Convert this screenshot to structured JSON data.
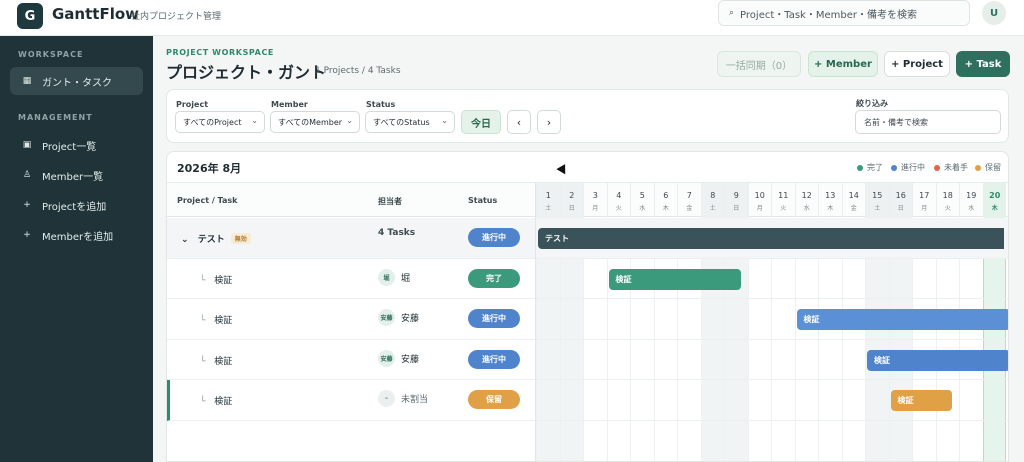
{
  "header": {
    "logo_letter": "G",
    "app_name": "GanttFlow",
    "subtitle": "社内プロジェクト管理",
    "search_placeholder": "Project・Task・Member・備考を検索",
    "search_icon": "search-icon",
    "avatar_initial": "U"
  },
  "sidebar": {
    "section_workspace": "WORKSPACE",
    "section_management": "MANAGEMENT",
    "items": [
      {
        "label": "ガント・タスク",
        "icon": "▦",
        "active": true
      },
      {
        "label": "Project一覧",
        "icon": "▣",
        "active": false
      },
      {
        "label": "Member一覧",
        "icon": "♙",
        "active": false
      },
      {
        "label": "Projectを追加",
        "icon": "+",
        "active": false
      },
      {
        "label": "Memberを追加",
        "icon": "+",
        "active": false
      }
    ]
  },
  "page": {
    "eyebrow": "PROJECT WORKSPACE",
    "title": "プロジェクト・ガント",
    "counts": "1 Projects / 4 Tasks"
  },
  "actions": {
    "sync": "一括同期（0）",
    "member": "+ Member",
    "project": "+ Project",
    "task": "+ Task"
  },
  "filters": {
    "project_label": "Project",
    "project_value": "すべてのProject",
    "member_label": "Member",
    "member_value": "すべてのMember",
    "status_label": "Status",
    "status_value": "すべてのStatus",
    "today": "今日",
    "prev": "‹",
    "next": "›",
    "narrow_label": "絞り込み",
    "narrow_placeholder": "名前・備考で検索"
  },
  "gantt": {
    "month": "2026年 8月",
    "legend": [
      {
        "label": "完了",
        "color": "#3b9a7c"
      },
      {
        "label": "進行中",
        "color": "#4f84cc"
      },
      {
        "label": "未着手",
        "color": "#e0644a"
      },
      {
        "label": "保留",
        "color": "#e0a045"
      }
    ],
    "columns": {
      "task": "Project / Task",
      "assignee": "担当者",
      "status": "Status"
    },
    "days": [
      {
        "n": "1",
        "w": "土"
      },
      {
        "n": "2",
        "w": "日"
      },
      {
        "n": "3",
        "w": "月"
      },
      {
        "n": "4",
        "w": "火"
      },
      {
        "n": "5",
        "w": "水"
      },
      {
        "n": "6",
        "w": "木"
      },
      {
        "n": "7",
        "w": "金"
      },
      {
        "n": "8",
        "w": "土"
      },
      {
        "n": "9",
        "w": "日"
      },
      {
        "n": "10",
        "w": "月"
      },
      {
        "n": "11",
        "w": "火"
      },
      {
        "n": "12",
        "w": "水"
      },
      {
        "n": "13",
        "w": "木"
      },
      {
        "n": "14",
        "w": "金"
      },
      {
        "n": "15",
        "w": "土"
      },
      {
        "n": "16",
        "w": "日"
      },
      {
        "n": "17",
        "w": "月"
      },
      {
        "n": "18",
        "w": "火"
      },
      {
        "n": "19",
        "w": "水"
      },
      {
        "n": "20",
        "w": "木"
      }
    ],
    "rows": [
      {
        "type": "parent",
        "name": "テスト",
        "badge": "無効",
        "assignee": "4 Tasks",
        "status": "進行中",
        "status_color": "#4f84cc",
        "bar": {
          "label": "テスト",
          "start": 1,
          "end": 20,
          "color": "#3a525a"
        }
      },
      {
        "type": "child",
        "name": "検証",
        "avatar": "堀",
        "assignee": "堀",
        "status": "完了",
        "status_color": "#3b9a7c",
        "bar": {
          "label": "検証",
          "start": 4,
          "end": 8.8,
          "color": "#3b9a7c"
        }
      },
      {
        "type": "child",
        "name": "検証",
        "avatar": "安藤",
        "assignee": "安藤",
        "status": "進行中",
        "status_color": "#4f84cc",
        "bar": {
          "label": "検証",
          "start": 12,
          "end": 20.9,
          "color": "#5b8fd6"
        }
      },
      {
        "type": "child",
        "name": "検証",
        "avatar": "安藤",
        "assignee": "安藤",
        "status": "進行中",
        "status_color": "#4f84cc",
        "bar": {
          "label": "検証",
          "start": 15,
          "end": 21,
          "color": "#4f84cc"
        }
      },
      {
        "type": "child",
        "name": "検証",
        "avatar": "–",
        "assignee": "未割当",
        "status": "保留",
        "status_color": "#e0a045",
        "selected": true,
        "bar": {
          "label": "検証",
          "start": 16,
          "end": 17.8,
          "color": "#e0a045"
        }
      }
    ]
  }
}
